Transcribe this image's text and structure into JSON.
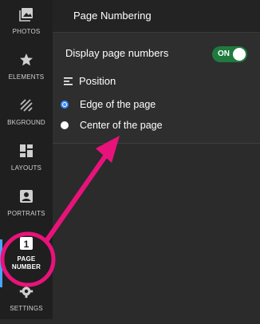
{
  "sidebar": {
    "items": [
      {
        "label": "PHOTOS",
        "icon": "photos-icon"
      },
      {
        "label": "ELEMENTS",
        "icon": "star-icon"
      },
      {
        "label": "BKGROUND",
        "icon": "background-pattern-icon"
      },
      {
        "label": "LAYOUTS",
        "icon": "layouts-icon"
      },
      {
        "label": "PORTRAITS",
        "icon": "portrait-icon"
      },
      {
        "label": "PAGE NUMBER",
        "icon": "page-number-icon",
        "badge": "1",
        "active": true
      },
      {
        "label": "SETTINGS",
        "icon": "gear-icon"
      }
    ]
  },
  "panel": {
    "title": "Page Numbering",
    "display_label": "Display page numbers",
    "toggle": {
      "text": "ON",
      "on": true
    },
    "position_heading": "Position",
    "options": [
      {
        "label": "Edge of the page",
        "selected": true
      },
      {
        "label": "Center of the page",
        "selected": false
      }
    ]
  },
  "colors": {
    "accent_blue": "#3d8bff",
    "toggle_green": "#1f7a3e",
    "annotation_pink": "#e8137a"
  }
}
